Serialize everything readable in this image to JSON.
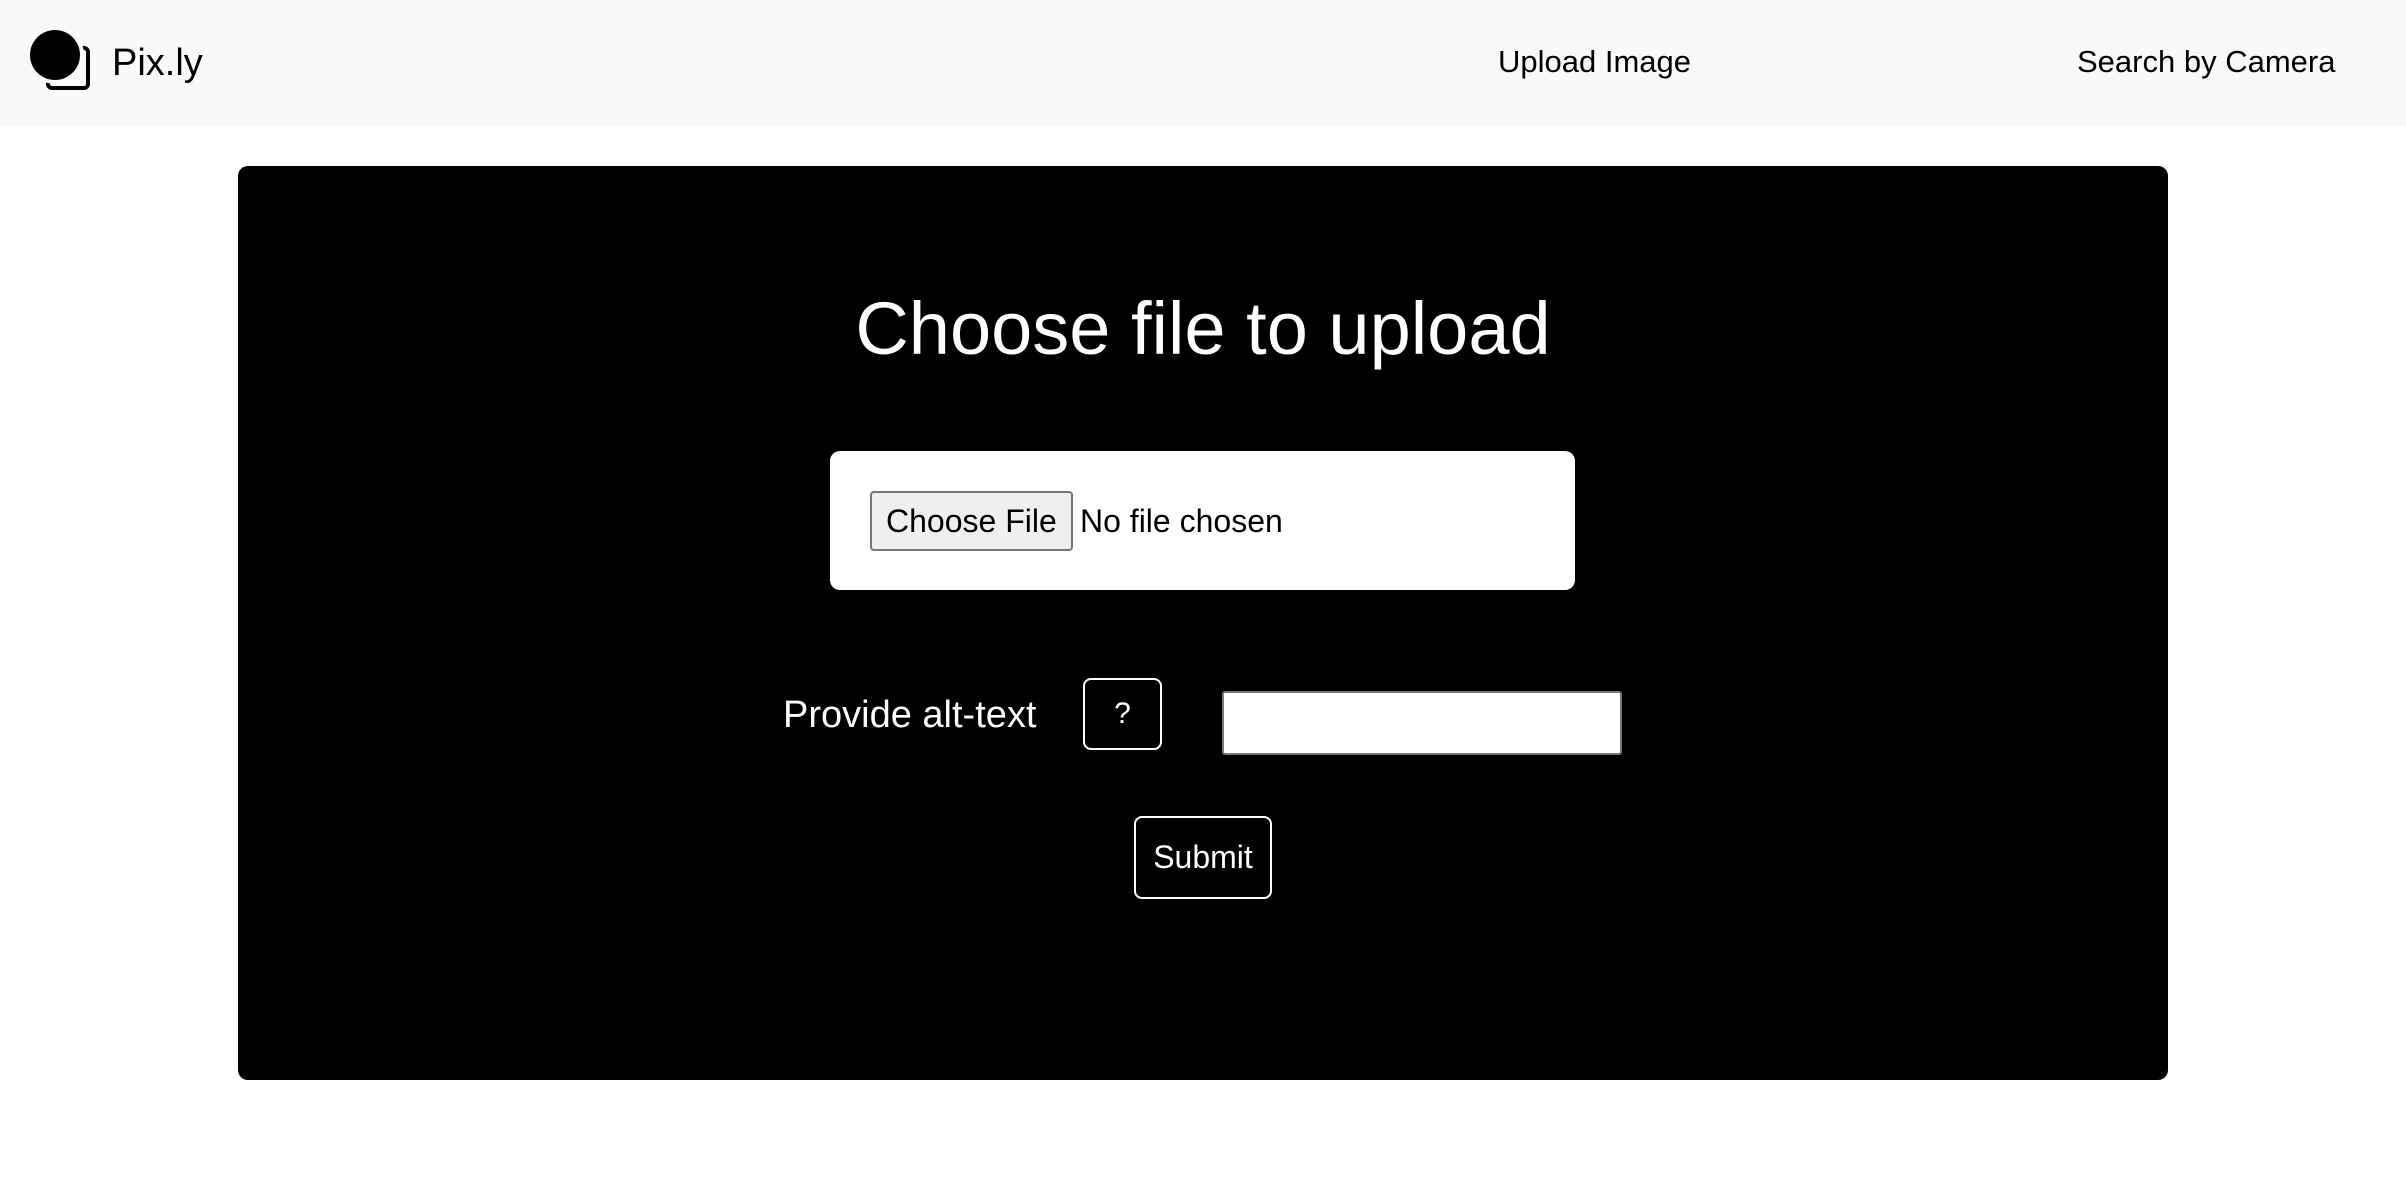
{
  "navbar": {
    "brand_name": "Pix.ly",
    "links": {
      "upload": "Upload Image",
      "camera": "Search by Camera"
    }
  },
  "upload_form": {
    "title": "Choose file to upload",
    "file_input": {
      "button_label": "Choose File",
      "status_text": "No file chosen"
    },
    "alt_text": {
      "label": "Provide alt-text",
      "help_button_label": "?",
      "value": ""
    },
    "submit_label": "Submit"
  },
  "colors": {
    "navbar_bg": "#f8f9fa",
    "card_bg": "#000000",
    "text_on_card": "#ffffff"
  },
  "icons": {
    "brand": "image-gallery-icon"
  }
}
